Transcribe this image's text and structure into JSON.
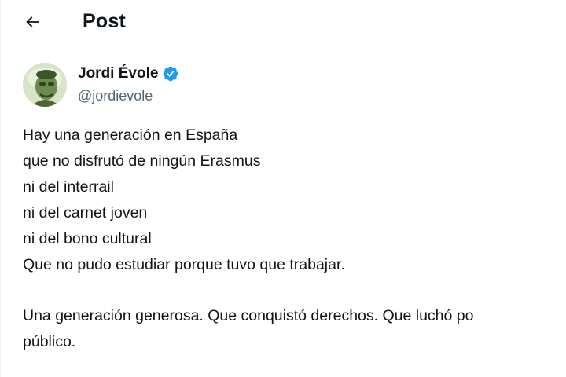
{
  "header": {
    "back_icon": "arrow-left-icon",
    "title": "Post"
  },
  "author": {
    "display_name": "Jordi Évole",
    "handle": "@jordievole",
    "verified_icon": "verified-badge-icon",
    "verified_color": "#1d9bf0",
    "avatar_icon": "avatar-photo"
  },
  "tweet": {
    "lines": [
      "Hay una generación en España",
      "que no disfrutó de ningún Erasmus",
      "ni del interrail",
      "ni del carnet joven",
      "ni del bono cultural",
      "Que no pudo estudiar porque tuvo que trabajar."
    ],
    "paragraph_2_lines": [
      "Una generación generosa. Que conquistó derechos. Que luchó po",
      "público."
    ]
  },
  "colors": {
    "text": "#0f1419",
    "secondary_text": "#536471",
    "accent": "#1d9bf0"
  }
}
